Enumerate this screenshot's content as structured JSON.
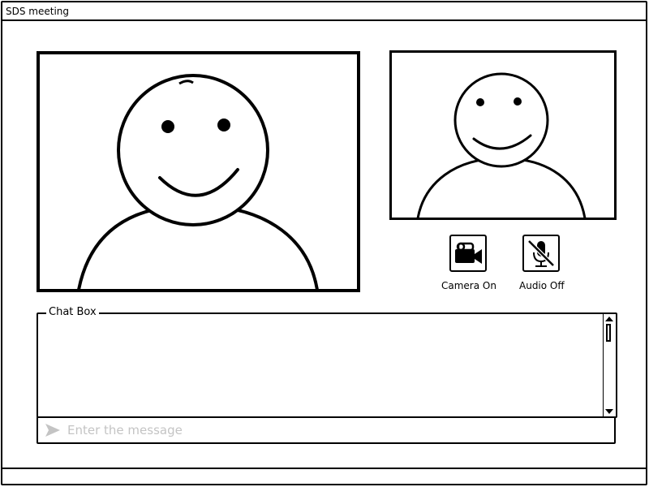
{
  "window": {
    "title": "SDS meeting"
  },
  "video": {
    "main": {
      "icon": "person-avatar-icon"
    },
    "self": {
      "icon": "person-avatar-icon"
    }
  },
  "controls": {
    "camera": {
      "label": "Camera On",
      "icon": "video-camera-icon",
      "state": "on"
    },
    "audio": {
      "label": "Audio Off",
      "icon": "microphone-muted-icon",
      "state": "off"
    }
  },
  "chat": {
    "legend": "Chat Box",
    "messages": [],
    "input": {
      "value": "",
      "placeholder": "Enter the message"
    },
    "send_icon": "send-icon"
  },
  "colors": {
    "stroke": "#000000",
    "placeholder": "#c4c4c4",
    "background": "#ffffff"
  }
}
